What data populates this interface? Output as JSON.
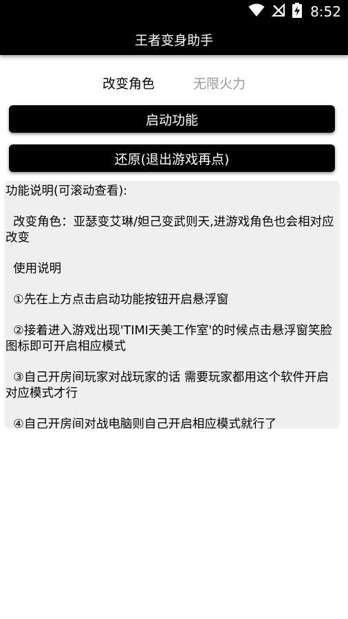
{
  "status_bar": {
    "time": "8:52",
    "icons": [
      "wifi-icon",
      "no-signal-icon",
      "battery-charging-icon"
    ]
  },
  "app_bar": {
    "title": "王者变身助手"
  },
  "tabs": [
    {
      "label": "改变角色",
      "active": true
    },
    {
      "label": "无限火力",
      "active": false
    }
  ],
  "buttons": {
    "start": "启动功能",
    "restore": "还原(退出游戏再点)"
  },
  "description": {
    "heading": "功能说明(可滚动查看):",
    "item_change_role": "  改变角色：亚瑟变艾琳/妲己变武则天,进游戏角色也会相对应改变",
    "usage_heading": "  使用说明",
    "step1": "  ①先在上方点击启动功能按钮开启悬浮窗",
    "step2": "  ②接着进入游戏出现'TIMI天美工作室'的时候点击悬浮窗笑脸图标即可开启相应模式",
    "step3": "  ③自己开房间玩家对战玩家的话 需要玩家都用这个软件开启对应模式才行",
    "step4": "  ④自己开房间对战电脑则自己开启相应模式就行了"
  },
  "colors": {
    "bar": "#000000",
    "tab_inactive": "#9a9a9a",
    "desc_bg": "#efefef"
  }
}
